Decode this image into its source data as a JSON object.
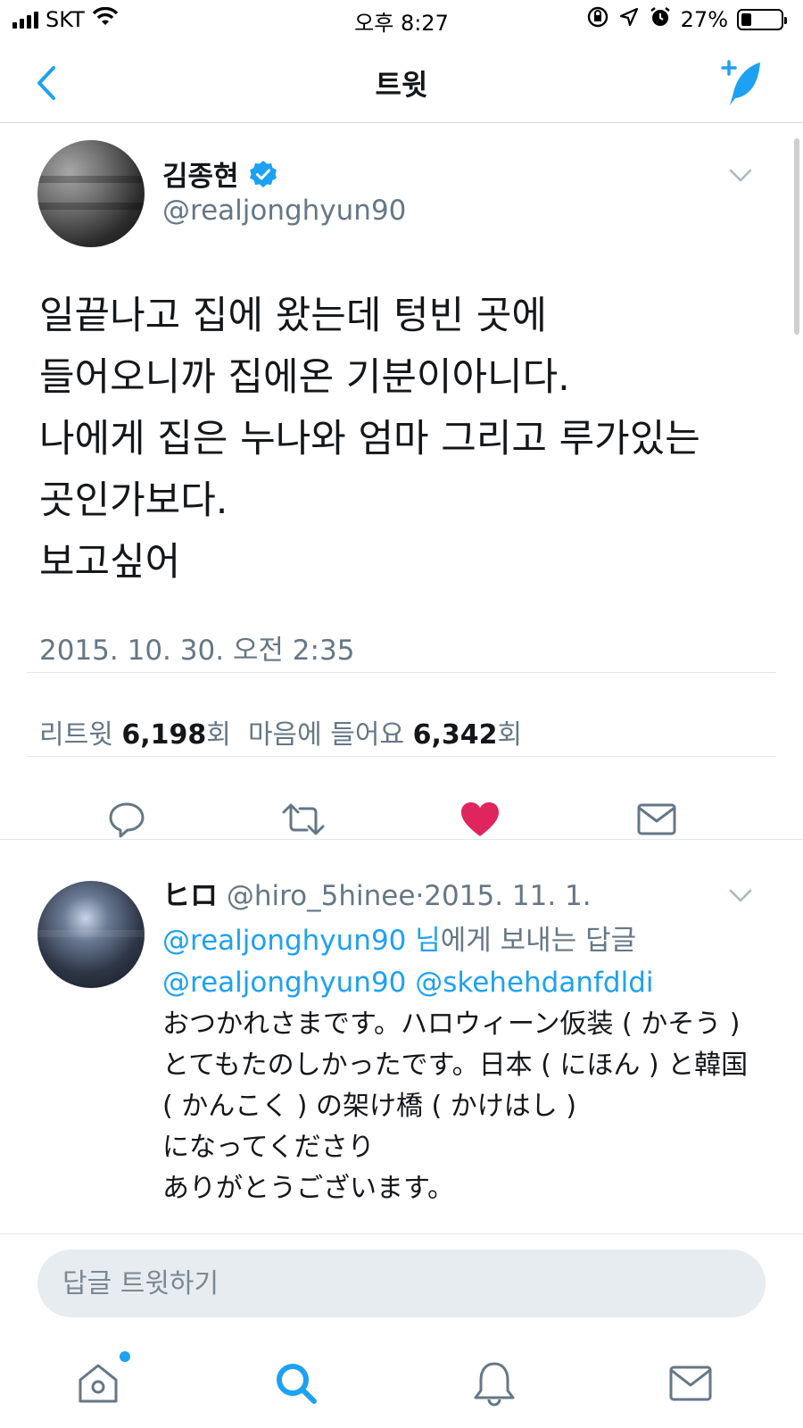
{
  "status_bar": {
    "carrier": "SKT",
    "time": "오후 8:27",
    "battery": "27%",
    "battery_level": 0.27
  },
  "nav": {
    "title": "트윗",
    "accent_color": "#1da1f2"
  },
  "tweet": {
    "author_name": "김종현",
    "author_handle": "@realjonghyun90",
    "verified": true,
    "text_lines": [
      "일끝나고 집에 왔는데 텅빈 곳에",
      "들어오니까 집에온 기분이아니다.",
      "나에게 집은 누나와 엄마 그리고 루가있는",
      "곳인가보다.",
      "보고싶어"
    ],
    "timestamp": "2015. 10. 30. 오전 2:35",
    "stats": {
      "retweet_label": "리트윗",
      "retweet_count": "6,198",
      "like_label": "마음에 들어요",
      "like_count": "6,342",
      "count_suffix": "회"
    },
    "liked": true,
    "like_color": "#e0245e"
  },
  "reply": {
    "name": "ヒロ",
    "handle": "@hiro_5hinee",
    "separator": "·",
    "date": "2015. 11. 1.",
    "reply_to_handle": "@realjonghyun90 님",
    "reply_to_suffix": "에게 보내는 답글",
    "mentions": "@realjonghyun90 @skehehdanfdldi",
    "body_lines": [
      "おつかれさまです。ハロウィーン仮装 ( かそう )",
      "とてもたのしかったです。日本 ( にほん ) と韓国",
      "( かんこく ) の架け橋 ( かけはし )",
      "になってくださり",
      "ありがとうございます。"
    ]
  },
  "composer": {
    "placeholder": "답글 트윗하기"
  },
  "tab_bar": {
    "items": [
      {
        "icon": "home-icon",
        "has_notification_dot": true
      },
      {
        "icon": "search-icon",
        "active": true
      },
      {
        "icon": "bell-icon"
      },
      {
        "icon": "mail-icon"
      }
    ]
  }
}
